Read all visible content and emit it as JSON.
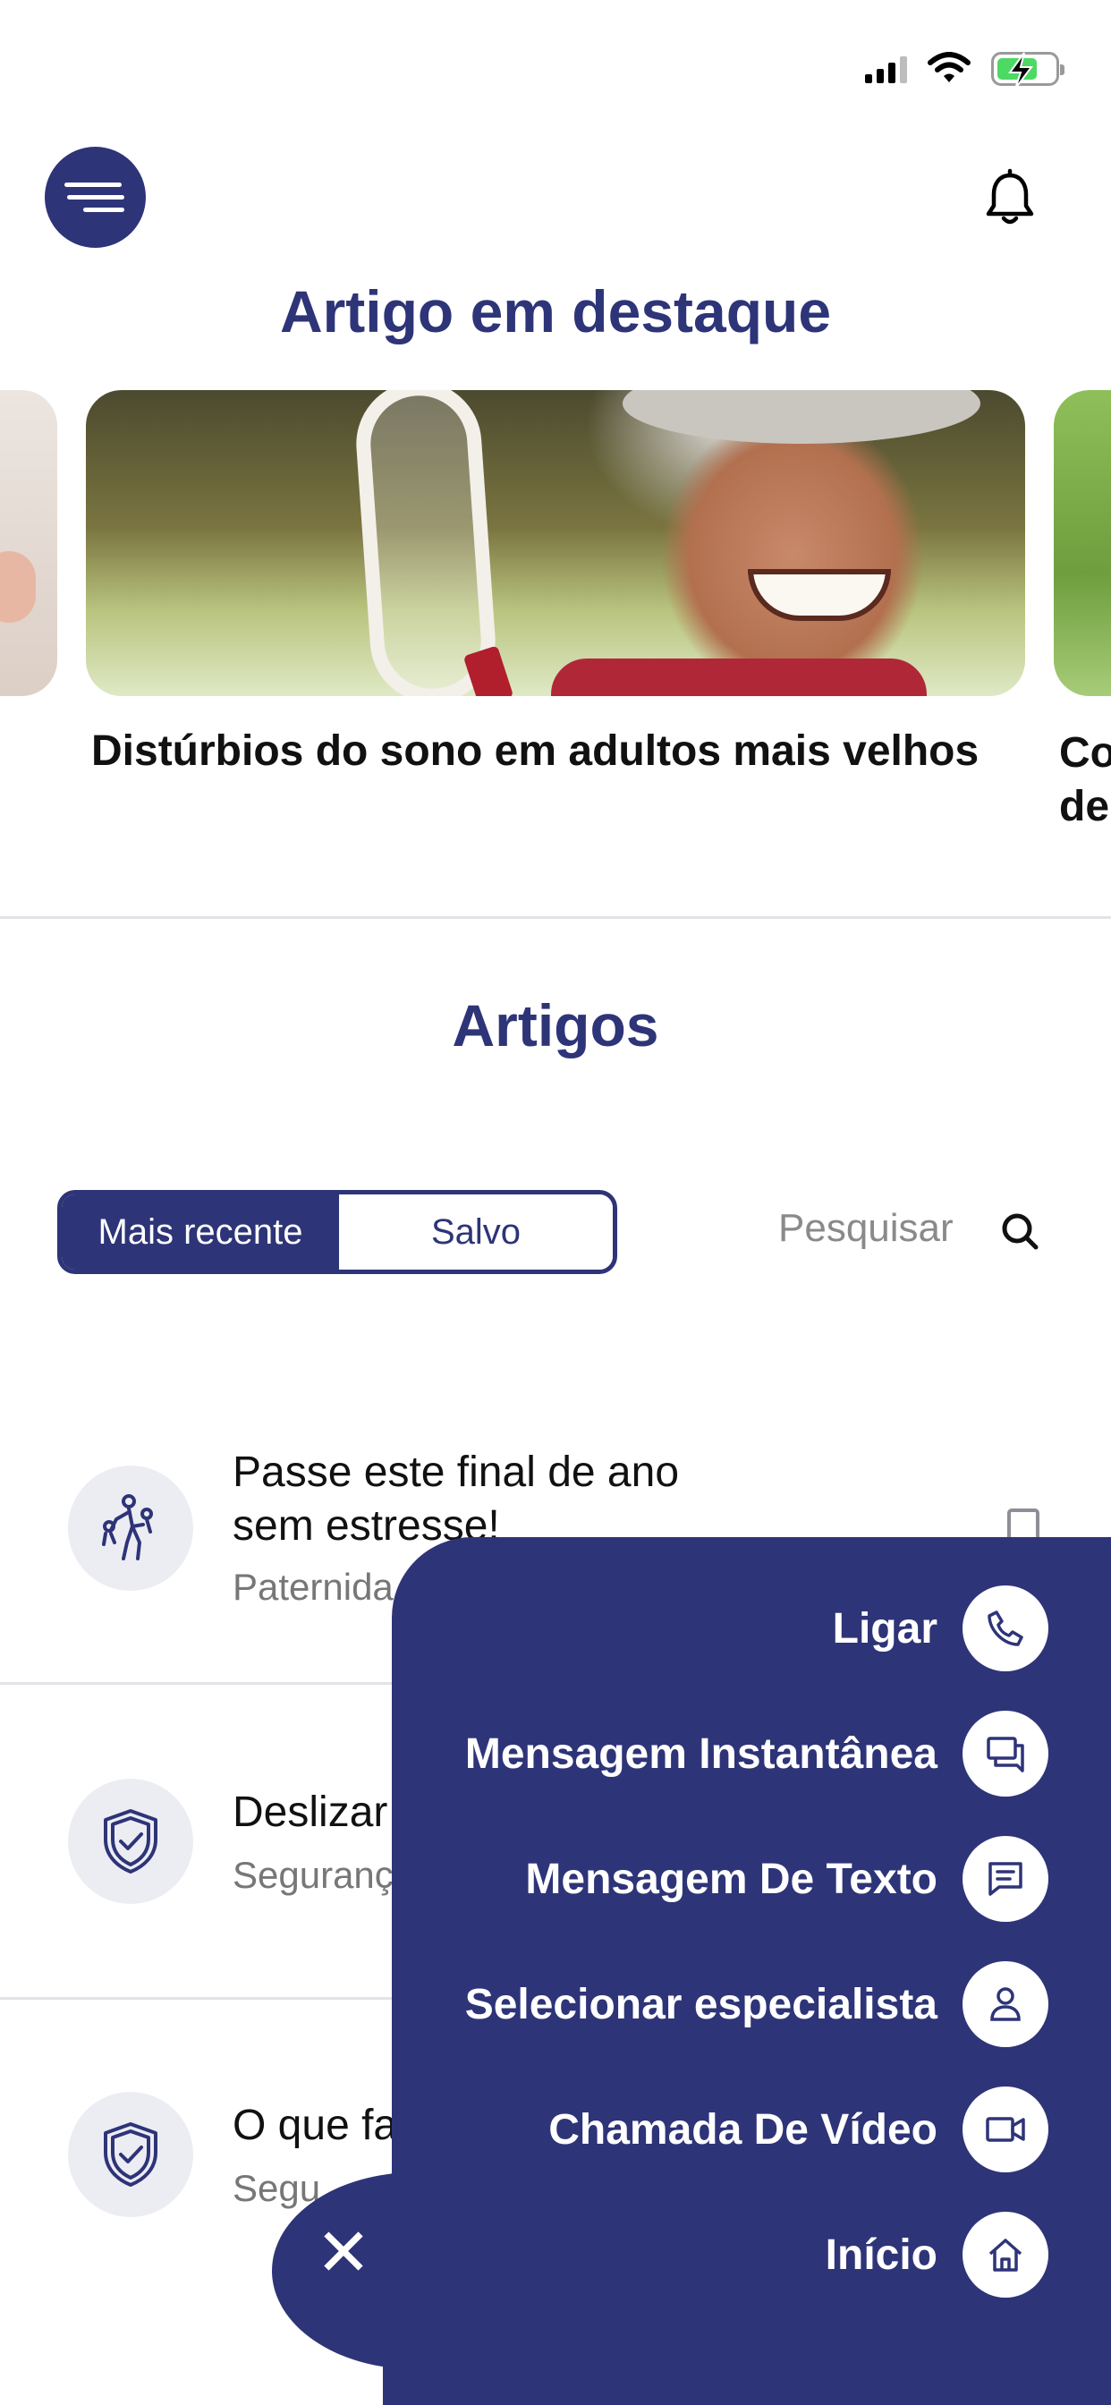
{
  "status_bar": {
    "icons": [
      "signal-icon",
      "wifi-icon",
      "battery-charging-icon"
    ]
  },
  "header": {
    "menu_icon": "menu-icon",
    "notification_icon": "bell-icon"
  },
  "featured": {
    "title": "Artigo em destaque",
    "cards": [
      {
        "title": "Distúrbios do sono em adultos mais velhos"
      },
      {
        "title_partial_line1": "Co",
        "title_partial_line2": "de"
      }
    ]
  },
  "articles": {
    "title": "Artigos",
    "tabs": [
      {
        "label": "Mais recente",
        "selected": true
      },
      {
        "label": "Salvo",
        "selected": false
      }
    ],
    "search": {
      "label": "Pesquisar"
    },
    "items": [
      {
        "title_line1": "Passe este final de ano",
        "title_line2": "sem estresse!",
        "category": "Paternida",
        "icon": "parent-child-icon"
      },
      {
        "title": "Deslizar",
        "category": "Seguranç",
        "icon": "shield-check-icon"
      },
      {
        "title": "O que fa",
        "category": "Segu",
        "icon": "shield-check-icon"
      }
    ]
  },
  "fab_menu": {
    "close_label": "✕",
    "options": [
      {
        "label": "Ligar",
        "icon": "phone-icon"
      },
      {
        "label": "Mensagem Instantânea",
        "icon": "chat-bubbles-icon"
      },
      {
        "label": "Mensagem De Texto",
        "icon": "message-icon"
      },
      {
        "label": "Selecionar especialista",
        "icon": "person-icon"
      },
      {
        "label": "Chamada De Vídeo",
        "icon": "video-camera-icon"
      },
      {
        "label": "Início",
        "icon": "home-icon"
      }
    ]
  },
  "colors": {
    "primary": "#2e3478",
    "icon_bg": "#ecedf3",
    "divider": "#e2e2e8"
  }
}
